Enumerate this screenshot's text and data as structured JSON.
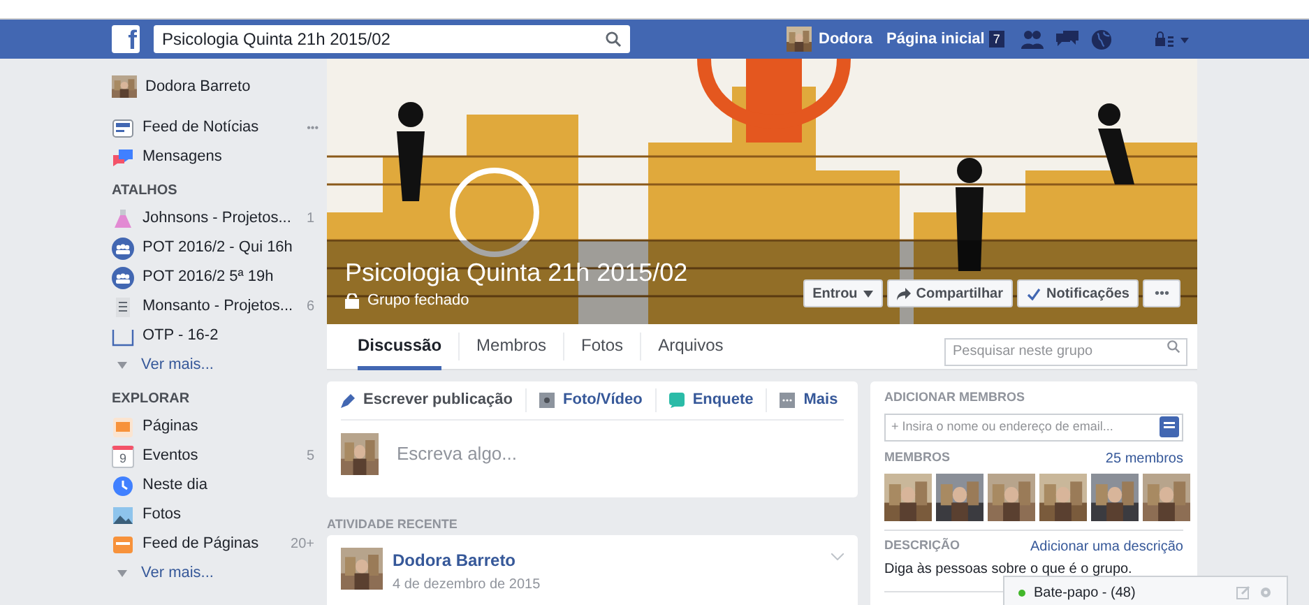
{
  "topbar": {
    "logo": "f",
    "search_value": "Psicologia Quinta 21h 2015/02",
    "user": "Dodora",
    "home": "Página inicial",
    "home_count": "7"
  },
  "sidebar": {
    "profile": "Dodora Barreto",
    "top_items": [
      {
        "label": "Feed de Notícias",
        "kind": "news",
        "more": "•••"
      },
      {
        "label": "Mensagens",
        "kind": "messages"
      }
    ],
    "sections": [
      {
        "title": "ATALHOS",
        "items": [
          {
            "label": "Johnsons - Projetos...",
            "kind": "flask",
            "count": "1"
          },
          {
            "label": "POT 2016/2 - Qui 16h",
            "kind": "group"
          },
          {
            "label": "POT 2016/2 5ª 19h",
            "kind": "group"
          },
          {
            "label": "Monsanto - Projetos...",
            "kind": "doc",
            "count": "6"
          },
          {
            "label": "OTP - 16-2",
            "kind": "book"
          }
        ],
        "more": "Ver mais..."
      },
      {
        "title": "EXPLORAR",
        "items": [
          {
            "label": "Páginas",
            "kind": "flag"
          },
          {
            "label": "Eventos",
            "kind": "calendar",
            "count": "5",
            "calendar_day": "9"
          },
          {
            "label": "Neste dia",
            "kind": "history"
          },
          {
            "label": "Fotos",
            "kind": "photos"
          },
          {
            "label": "Feed de Páginas",
            "kind": "pagefeed",
            "count": "20+"
          }
        ],
        "more": "Ver mais..."
      }
    ]
  },
  "cover": {
    "title": "Psicologia Quinta 21h 2015/02",
    "privacy": "Grupo fechado",
    "buttons": [
      {
        "label": "Entrou",
        "kind": "dropdown"
      },
      {
        "label": "Compartilhar",
        "kind": "share"
      },
      {
        "label": "Notificações",
        "kind": "check"
      },
      {
        "label": "•••",
        "kind": "more"
      }
    ]
  },
  "tabs": [
    {
      "label": "Discussão",
      "selected": true
    },
    {
      "label": "Membros",
      "selected": false
    },
    {
      "label": "Fotos",
      "selected": false
    },
    {
      "label": "Arquivos",
      "selected": false
    }
  ],
  "group_search": {
    "placeholder": "Pesquisar neste grupo"
  },
  "composer": {
    "actions": [
      {
        "label": "Escrever publicação",
        "kind": "pencil"
      },
      {
        "label": "Foto/Vídeo",
        "kind": "camera"
      },
      {
        "label": "Enquete",
        "kind": "poll"
      },
      {
        "label": "Mais",
        "kind": "more"
      }
    ],
    "placeholder": "Escreva algo..."
  },
  "recent": {
    "title": "ATIVIDADE RECENTE",
    "post": {
      "author": "Dodora Barreto",
      "date": "4 de dezembro de 2015"
    }
  },
  "side": {
    "add_title": "ADICIONAR MEMBROS",
    "add_placeholder": "+ Insira o nome ou endereço de email...",
    "members_title": "MEMBROS",
    "members_count": "25 membros",
    "desc_title": "DESCRIÇÃO",
    "desc_link": "Adicionar uma descrição",
    "desc_text": "Diga às pessoas sobre o que é o grupo."
  },
  "chat": {
    "label": "Bate-papo - (48)",
    "online": true
  }
}
